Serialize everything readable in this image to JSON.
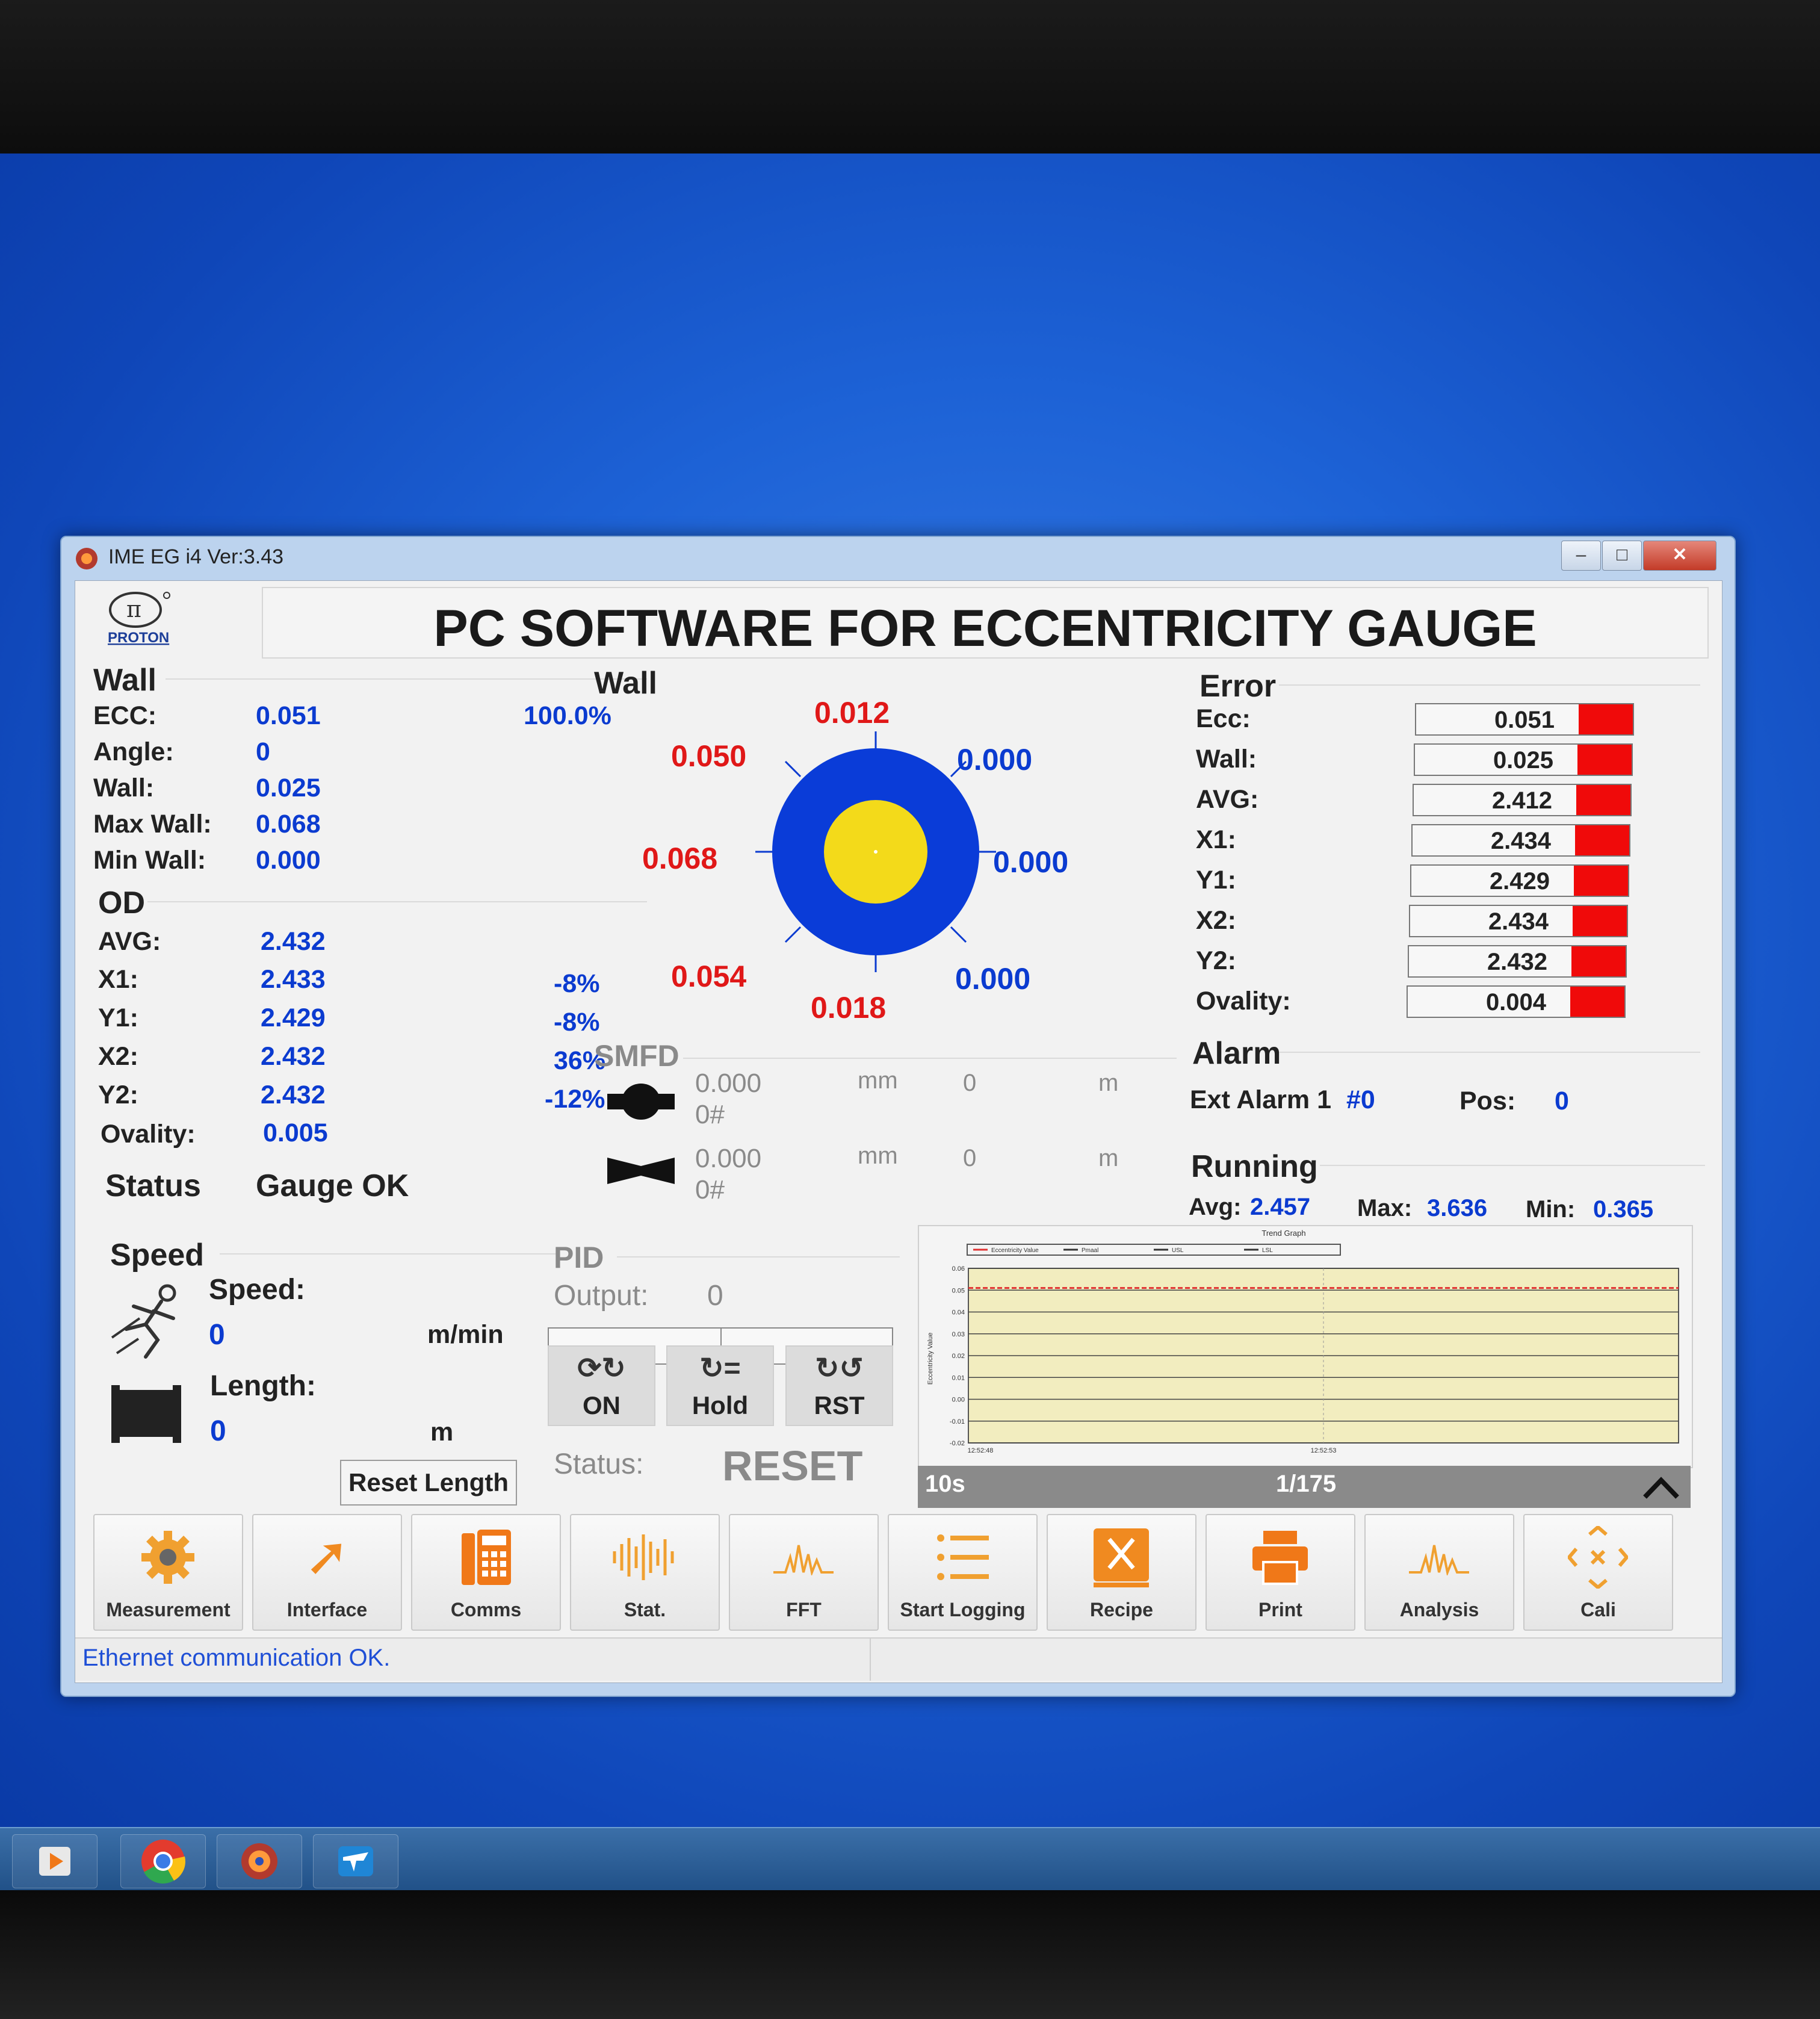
{
  "window": {
    "title": "IME EG i4 Ver:3.43"
  },
  "header": {
    "logo_text": "PROTON",
    "title": "PC SOFTWARE FOR ECCENTRICITY GAUGE"
  },
  "wall_panel": {
    "heading": "Wall",
    "rows": [
      {
        "label": "ECC:",
        "value": "0.051",
        "extra": "100.0%"
      },
      {
        "label": "Angle:",
        "value": "0"
      },
      {
        "label": "Wall:",
        "value": "0.025"
      },
      {
        "label": "Max Wall:",
        "value": "0.068"
      },
      {
        "label": "Min  Wall:",
        "value": "0.000"
      }
    ]
  },
  "od_panel": {
    "heading": "OD",
    "rows": [
      {
        "label": "AVG:",
        "value": "2.432"
      },
      {
        "label": "X1:",
        "value": "2.433",
        "extra": "-8%"
      },
      {
        "label": "Y1:",
        "value": "2.429",
        "extra": "-8%"
      },
      {
        "label": "X2:",
        "value": "2.432",
        "extra": "36%"
      },
      {
        "label": "Y2:",
        "value": "2.432",
        "extra": "-12%"
      },
      {
        "label": "Ovality:",
        "value": "0.005"
      }
    ]
  },
  "status": {
    "label": "Status",
    "value": "Gauge OK"
  },
  "wall_diagram": {
    "heading": "Wall",
    "top": "0.012",
    "top_right": "0.000",
    "right": "0.000",
    "bottom_right": "0.000",
    "bottom": "0.018",
    "bottom_left": "0.054",
    "left": "0.068",
    "top_left": "0.050",
    "colors": {
      "outer": "#0a3cd8",
      "inner": "#f3da1a",
      "red": "#e01818",
      "blue": "#0b3bd0"
    }
  },
  "smfd": {
    "heading": "SMFD",
    "rows": [
      {
        "value": "0.000",
        "sub": "0#",
        "unit": "mm",
        "count": "0",
        "unit2": "m"
      },
      {
        "value": "0.000",
        "sub": "0#",
        "unit": "mm",
        "count": "0",
        "unit2": "m"
      }
    ]
  },
  "error_panel": {
    "heading": "Error",
    "rows": [
      {
        "label": "Ecc:",
        "value": "0.051",
        "fill": 0.25
      },
      {
        "label": "Wall:",
        "value": "0.025",
        "fill": 0.25
      },
      {
        "label": "AVG:",
        "value": "2.412",
        "fill": 0.25
      },
      {
        "label": "X1:",
        "value": "2.434",
        "fill": 0.25
      },
      {
        "label": "Y1:",
        "value": "2.429",
        "fill": 0.25
      },
      {
        "label": "X2:",
        "value": "2.434",
        "fill": 0.25
      },
      {
        "label": "Y2:",
        "value": "2.432",
        "fill": 0.25
      },
      {
        "label": "Ovality:",
        "value": "0.004",
        "fill": 0.25
      }
    ]
  },
  "alarm_panel": {
    "heading": "Alarm",
    "label": "Ext Alarm 1",
    "code": "#0",
    "pos_label": "Pos:",
    "pos_value": "0"
  },
  "running_panel": {
    "heading": "Running",
    "avg_label": "Avg:",
    "avg": "2.457",
    "max_label": "Max:",
    "max": "3.636",
    "min_label": "Min:",
    "min": "0.365"
  },
  "speed_panel": {
    "heading": "Speed",
    "speed_label": "Speed:",
    "speed_value": "0",
    "speed_unit": "m/min",
    "length_label": "Length:",
    "length_value": "0",
    "length_unit": "m",
    "reset_button": "Reset Length"
  },
  "pid_panel": {
    "heading": "PID",
    "output_label": "Output:",
    "output_value": "0",
    "buttons": [
      "ON",
      "Hold",
      "RST"
    ],
    "status_label": "Status:",
    "status_value": "RESET"
  },
  "trend": {
    "title": "Trend Graph",
    "ylabel": "Eccentricity Value",
    "legend": [
      "Eccentricity Value",
      "Pmaal",
      "USL",
      "LSL"
    ],
    "y_ticks": [
      "0.06",
      "0.05",
      "0.04",
      "0.03",
      "0.02",
      "0.01",
      "0.00",
      "-0.01",
      "-0.02"
    ],
    "x_ticks": [
      "12:52:48",
      "12:52:53"
    ],
    "window": "10s",
    "page": "1/175",
    "line_value": 0.051
  },
  "toolbar": {
    "buttons": [
      {
        "label": "Measurement",
        "icon": "gear-icon"
      },
      {
        "label": "Interface",
        "icon": "plug-icon"
      },
      {
        "label": "Comms",
        "icon": "phone-icon"
      },
      {
        "label": "Stat.",
        "icon": "waveform-icon"
      },
      {
        "label": "FFT",
        "icon": "spectrum-icon"
      },
      {
        "label": "Start Logging",
        "icon": "list-icon"
      },
      {
        "label": "Recipe",
        "icon": "recipe-icon"
      },
      {
        "label": "Print",
        "icon": "printer-icon"
      },
      {
        "label": "Analysis",
        "icon": "analysis-icon"
      },
      {
        "label": "Cali",
        "icon": "calibrate-icon"
      }
    ]
  },
  "statusbar": {
    "message": "Ethernet communication OK."
  },
  "taskbar": {
    "items": [
      "media-player-icon",
      "chrome-icon",
      "ime-app-icon",
      "teamviewer-icon"
    ]
  }
}
